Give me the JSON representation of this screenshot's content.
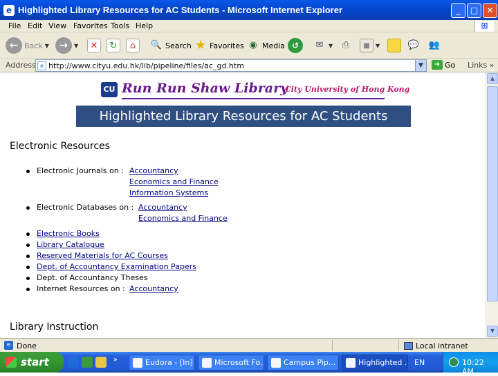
{
  "window": {
    "title": "Highlighted Library Resources for AC Students - Microsoft Internet Explorer"
  },
  "menu": [
    "File",
    "Edit",
    "View",
    "Favorites",
    "Tools",
    "Help"
  ],
  "toolbar": {
    "back": "Back",
    "search": "Search",
    "favorites": "Favorites",
    "media": "Media"
  },
  "address": {
    "label": "Address",
    "url": "http://www.cityu.edu.hk/lib/pipeline/files/ac_gd.htm",
    "go": "Go",
    "links": "Links"
  },
  "page": {
    "logo_name": "Run Run Shaw Library",
    "logo_university": "City University of Hong Kong",
    "banner": "Highlighted Library Resources for AC Students",
    "section1": "Electronic Resources",
    "ej_label": "Electronic Journals on :",
    "ej_links": [
      "Accountancy",
      "Economics and Finance",
      "Information Systems"
    ],
    "ed_label": "Electronic Databases on :",
    "ed_links": [
      "Accountancy",
      "Economics and Finance"
    ],
    "list": [
      {
        "text": "Electronic Books",
        "link": true
      },
      {
        "text": "Library Catalogue",
        "link": true
      },
      {
        "text": "Reserved Materials for AC Courses",
        "link": true
      },
      {
        "text": "Dept. of Accountancy Examination Papers",
        "link": true
      },
      {
        "text": "Dept. of Accountancy Theses",
        "link": false
      }
    ],
    "ir_label": "Internet Resources on :",
    "ir_link": "Accountancy",
    "section2": "Library Instruction"
  },
  "status": {
    "text": "Done",
    "zone": "Local intranet"
  },
  "taskbar": {
    "start": "start",
    "tasks": [
      "Eudora - [In]",
      "Microsoft Fo...",
      "Campus Pip...",
      "Highlighted ..."
    ],
    "lang": "EN",
    "clock": "10:22 AM"
  },
  "colors": {
    "banner_bg": "#2f4f82",
    "link": "#000080",
    "title_bar": "#0a58e8"
  }
}
